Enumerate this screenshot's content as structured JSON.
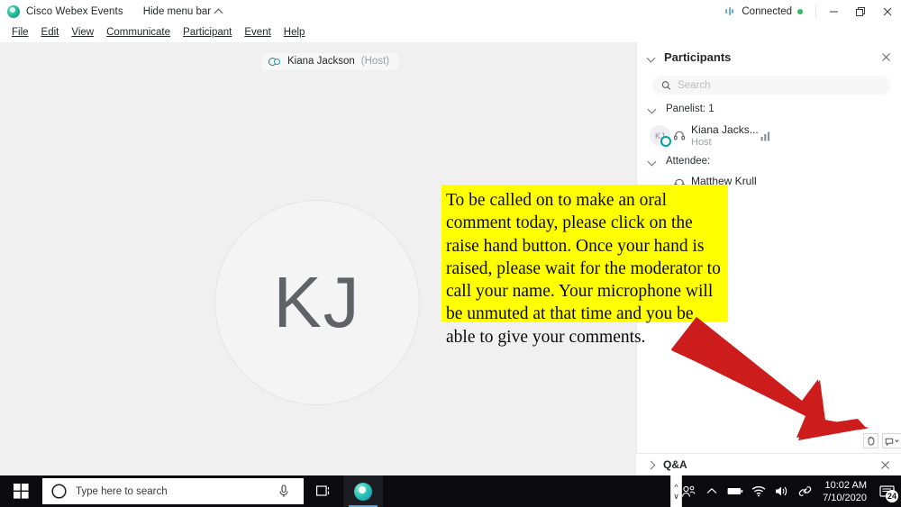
{
  "titlebar": {
    "app_title": "Cisco Webex Events",
    "hide_menu_label": "Hide menu bar",
    "connected_label": "Connected",
    "logo_icon": "webex-logo-icon",
    "chevron_icon": "chevron-up-icon",
    "connection_icon": "connection-strength-icon",
    "status_dot_color": "#2dbd63",
    "minimize_icon": "minimize-icon",
    "restore_icon": "restore-icon",
    "close_icon": "close-icon"
  },
  "menubar": {
    "items": [
      {
        "label": "File",
        "mnemonic": "F"
      },
      {
        "label": "Edit",
        "mnemonic": "E"
      },
      {
        "label": "View",
        "mnemonic": "V"
      },
      {
        "label": "Communicate",
        "mnemonic": "C"
      },
      {
        "label": "Participant",
        "mnemonic": "P"
      },
      {
        "label": "Event",
        "mnemonic": "E"
      },
      {
        "label": "Help",
        "mnemonic": "H"
      }
    ]
  },
  "stage": {
    "name_pill": {
      "name": "Kiana Jackson",
      "role": "(Host)",
      "icon": "video-participants-icon"
    },
    "avatar_initials": "KJ",
    "background_color": "#f0f0f0"
  },
  "annotation": {
    "callout_text": "To be called on to make an oral comment today, please click on the raise hand button. Once your hand is raised, please wait for the moderator to call your name. Your microphone will be unmuted at that time and you be able to give your comments.",
    "callout_bg": "#FFFF00",
    "arrow_color": "#CC1C1C",
    "arrow_icon": "red-arrow-annotation"
  },
  "panel": {
    "title": "Participants",
    "collapse_icon": "chevron-down-icon",
    "close_icon": "close-icon",
    "search": {
      "placeholder": "Search",
      "value": "",
      "icon": "search-icon"
    },
    "groups": [
      {
        "label": "Panelist: 1",
        "icon": "chevron-down-icon"
      },
      {
        "label": "Attendee:",
        "icon": "chevron-down-icon"
      }
    ],
    "panelists": [
      {
        "initials": "KJ",
        "name": "Kiana Jacks...",
        "role": "Host",
        "headset_icon": "headset-icon",
        "audio_icon": "audio-level-icon",
        "speaking_indicator_color": "#00a0a8"
      }
    ],
    "attendees": [
      {
        "name": "Matthew Krull",
        "headset_icon": "headset-icon",
        "avatar_glyph": "..."
      }
    ],
    "footer_buttons": [
      {
        "name": "raise-hand-button",
        "icon": "raise-hand-icon"
      },
      {
        "name": "reaction-dropdown-button",
        "icon": "reaction-chevron-icon"
      }
    ]
  },
  "qa": {
    "title": "Q&A",
    "expand_icon": "chevron-right-icon",
    "close_icon": "close-icon"
  },
  "scroll_spinner": {
    "up_icon": "chevron-up-icon",
    "down_icon": "chevron-down-icon"
  },
  "taskbar": {
    "start_icon": "windows-start-icon",
    "search_placeholder": "Type here to search",
    "search_circle_icon": "cortana-circle-icon",
    "mic_icon": "microphone-icon",
    "task_view_icon": "task-view-icon",
    "webex_app_icon": "webex-app-icon",
    "tray": {
      "overflow_up_icon": "chevron-up-icon",
      "people_icon": "meet-now-people-icon",
      "battery_icon": "battery-icon",
      "wifi_icon": "wifi-icon",
      "volume_icon": "volume-icon",
      "link_icon": "network-link-icon",
      "time": "10:02 AM",
      "date": "7/10/2020",
      "notification_icon": "action-center-icon",
      "notification_count": "24"
    }
  }
}
